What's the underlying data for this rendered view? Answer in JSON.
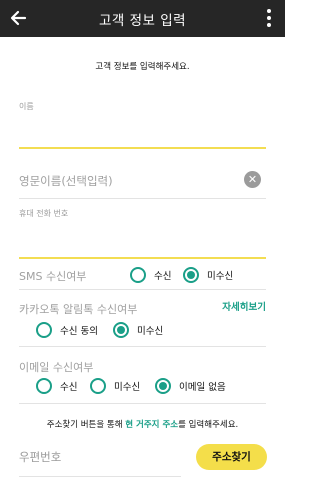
{
  "header": {
    "title": "고객 정보 입력",
    "back_icon": "back-arrow-icon",
    "menu_icon": "more-vertical-icon"
  },
  "intro": "고객 정보를 입력해주세요.",
  "fields": {
    "name_label": "이름",
    "name_value": "",
    "eng_name_placeholder": "영문이름(선택입력)",
    "phone_label": "휴대 전화 번호",
    "phone_value": ""
  },
  "sms": {
    "label": "SMS 수신여부",
    "options": [
      "수신",
      "미수신"
    ],
    "selected": "미수신"
  },
  "kakao": {
    "label": "카카오톡 알림톡 수신여부",
    "more": "자세히보기",
    "options": [
      "수신 동의",
      "미수신"
    ],
    "selected": "미수신"
  },
  "email": {
    "label": "이메일 수신여부",
    "options": [
      "수신",
      "미수신",
      "이메일 없음"
    ],
    "selected": "이메일 없음"
  },
  "address": {
    "note_pre": "주소찾기 버튼을 통해 ",
    "note_highlight": "현 거주지 주소",
    "note_post": "를 입력해주세요.",
    "zip_label": "우편번호",
    "search_button": "주소찾기"
  },
  "colors": {
    "header_bg": "#262626",
    "accent_green": "#1a9f88",
    "accent_yellow": "#f4de4a"
  }
}
